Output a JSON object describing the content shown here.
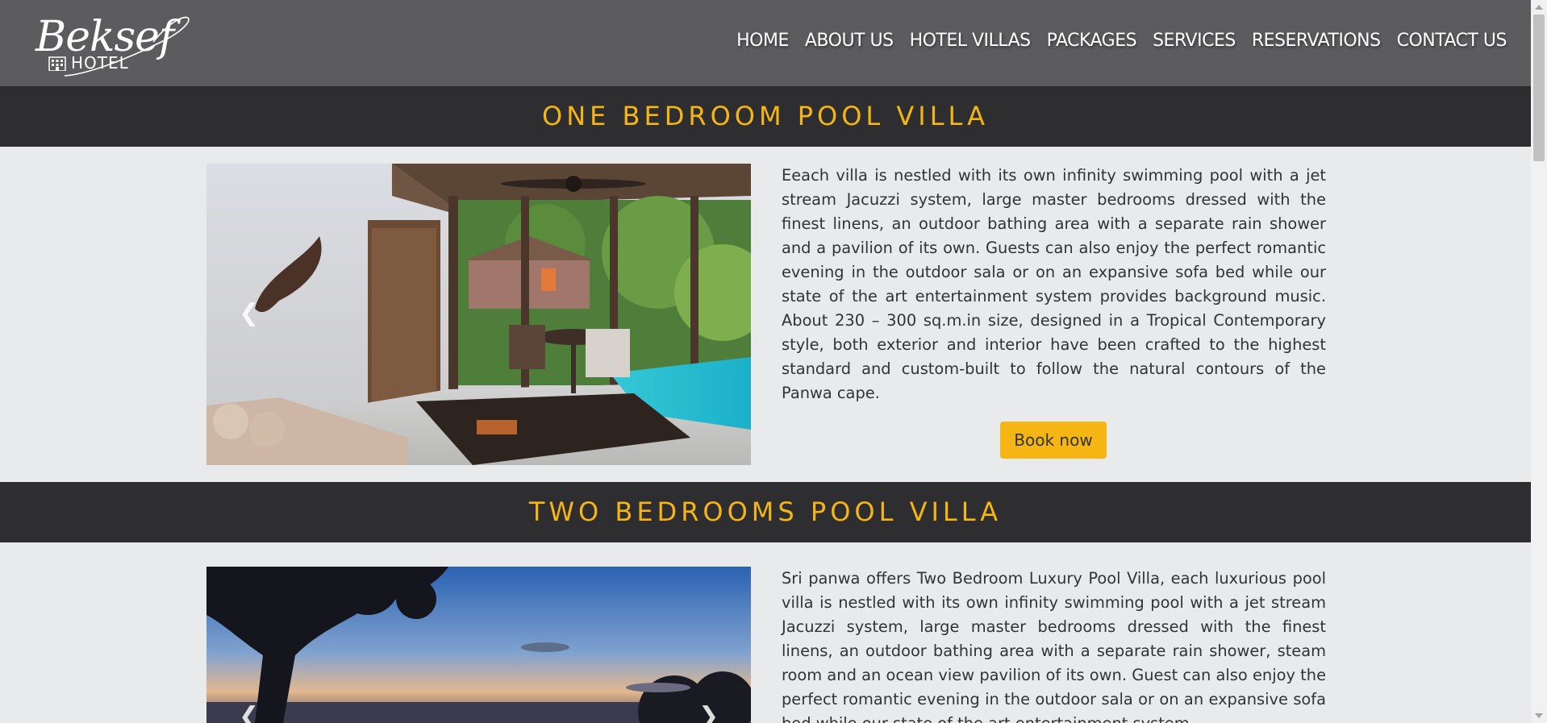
{
  "brand": {
    "logo_script": "Beksef",
    "logo_sub": "HOTEL"
  },
  "nav": [
    "HOME",
    "ABOUT US",
    "HOTEL VILLAS",
    "PACKAGES",
    "SERVICES",
    "RESERVATIONS",
    "CONTACT US"
  ],
  "sections": [
    {
      "title": "ONE BEDROOM POOL VILLA",
      "description": "Eeach villa is nestled with its own infinity swimming pool with a jet stream Jacuzzi system, large master bedrooms dressed with the finest linens, an outdoor bathing area with a separate rain shower and a pavilion of its own. Guests can also enjoy the perfect romantic evening in the outdoor sala or on an expansive sofa bed while our state of the art entertainment system provides background music. About 230 – 300 sq.m.in size, designed in a Tropical Contemporary style, both exterior and interior have been crafted to the highest standard and custom-built to follow the natural contours of the Panwa cape.",
      "button": "Book now",
      "carousel_prev_icon": "chevron-left-icon"
    },
    {
      "title": "TWO BEDROOMS POOL VILLA",
      "description": "Sri panwa offers Two Bedroom Luxury Pool Villa, each luxurious pool villa is nestled with its own infinity swimming pool with a jet stream Jacuzzi system, large master bedrooms dressed with the finest linens, an outdoor bathing area with a separate rain shower, steam room and an ocean view pavilion of its own. Guest can also enjoy the perfect romantic evening in the outdoor sala or on an expansive sofa bed while our state of the art entertainment system",
      "carousel_prev_icon": "chevron-left-icon",
      "carousel_next_icon": "chevron-right-icon"
    }
  ],
  "colors": {
    "header": "#5c5c5e",
    "banner": "#2e2e30",
    "accent": "#f5b614",
    "background": "#e9eaeb"
  }
}
